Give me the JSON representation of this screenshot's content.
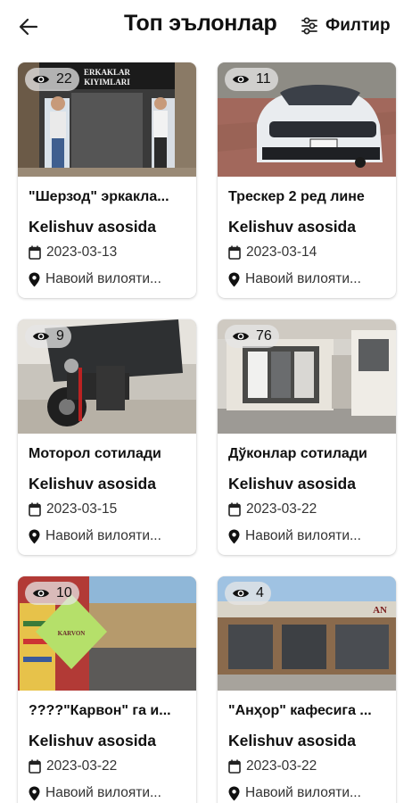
{
  "header": {
    "title": "Топ эълонлар",
    "filter_label": "Филтир"
  },
  "listings": [
    {
      "views": "22",
      "title": "\"Шерзод\" эркакла...",
      "price": "Kelishuv asosida",
      "date": "2023-03-13",
      "location": "Навоий вилояти...",
      "sign_text": "ERKAKLAR\nKIYIMLARI"
    },
    {
      "views": "11",
      "title": "Трескер 2 ред лине",
      "price": "Kelishuv asosida",
      "date": "2023-03-14",
      "location": "Навоий вилояти..."
    },
    {
      "views": "9",
      "title": "Моторол сотилади",
      "price": "Kelishuv asosida",
      "date": "2023-03-15",
      "location": "Навоий вилояти..."
    },
    {
      "views": "76",
      "title": "Дўконлар сотилади",
      "price": "Kelishuv asosida",
      "date": "2023-03-22",
      "location": "Навоий вилояти..."
    },
    {
      "views": "10",
      "title": "????\"Карвон\" га и...",
      "price": "Kelishuv asosida",
      "date": "2023-03-22",
      "location": "Навоий вилояти...",
      "sign_text": "KARVON"
    },
    {
      "views": "4",
      "title": "\"Анҳор\" кафесига ...",
      "price": "Kelishuv asosida",
      "date": "2023-03-22",
      "location": "Навоий вилояти...",
      "sign_text": "AN"
    }
  ],
  "icons": {
    "back": "arrow-left-icon",
    "filter": "sliders-icon",
    "views": "eye-icon",
    "date": "calendar-icon",
    "location": "location-pin-icon"
  }
}
